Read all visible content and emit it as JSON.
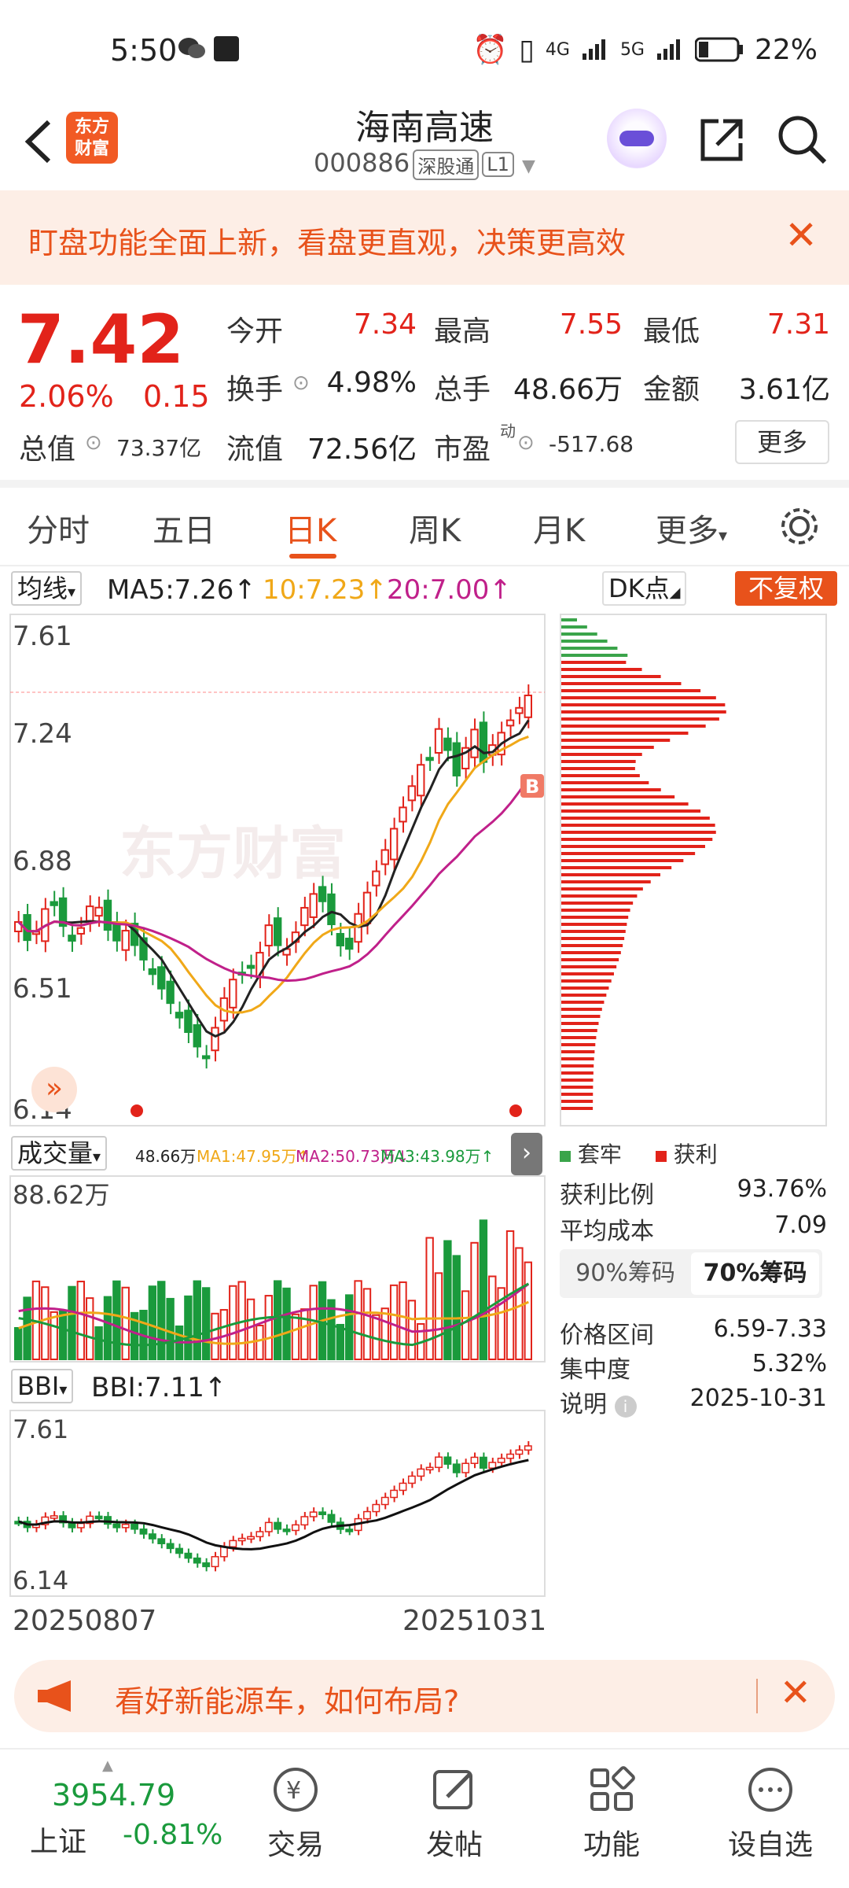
{
  "status": {
    "time": "5:50",
    "battery": "22%",
    "net1": "4G",
    "net2": "5G"
  },
  "header": {
    "title": "海南高速",
    "code": "000886",
    "tag1": "深股通",
    "tag2": "L1",
    "logo_line1": "东方",
    "logo_line2": "财富"
  },
  "banner": {
    "text": "盯盘功能全面上新，看盘更直观，决策更高效"
  },
  "quote": {
    "price": "7.42",
    "pct": "2.06%",
    "change": "0.15",
    "open_label": "今开",
    "open": "7.34",
    "high_label": "最高",
    "high": "7.55",
    "low_label": "最低",
    "low": "7.31",
    "turnover_label": "换手",
    "turnover": "4.98%",
    "volume_label": "总手",
    "volume": "48.66万",
    "amount_label": "金额",
    "amount": "3.61亿",
    "mktcap_label": "总值",
    "mktcap": "73.37亿",
    "float_label": "流值",
    "float": "72.56亿",
    "pe_label": "市盈",
    "pe_sup": "动",
    "pe": "-517.68",
    "more": "更多"
  },
  "tabs": [
    "分时",
    "五日",
    "日K",
    "周K",
    "月K",
    "更多"
  ],
  "ma": {
    "selector": "均线",
    "ma5": "MA5:7.26↑",
    "ma10": "10:7.23↑",
    "ma20": "20:7.00↑",
    "dk": "DK点",
    "fq": "不复权",
    "watermark": "东方财富",
    "buy_marker": "B"
  },
  "kline_axis": {
    "y1": "7.61",
    "y2": "7.24",
    "y3": "6.88",
    "y4": "6.51",
    "y5": "6.14"
  },
  "volume": {
    "selector": "成交量",
    "vol": "48.66万",
    "ma1": "MA1:47.95万↑",
    "ma2": "MA2:50.73万↓",
    "ma3": "MA3:43.98万↑",
    "max": "88.62万"
  },
  "bbi": {
    "selector": "BBI",
    "value": "BBI:7.11↑",
    "y_top": "7.61",
    "y_bot": "6.14"
  },
  "dates": {
    "start": "20250807",
    "end": "20251031"
  },
  "chips": {
    "legend_trap": "套牢",
    "legend_profit": "获利",
    "profit_ratio_label": "获利比例",
    "profit_ratio": "93.76%",
    "avg_cost_label": "平均成本",
    "avg_cost": "7.09",
    "btn90": "90%筹码",
    "btn70": "70%筹码",
    "range_label": "价格区间",
    "range": "6.59-7.33",
    "conc_label": "集中度",
    "conc": "5.32%",
    "note_label": "说明",
    "note_date": "2025-10-31"
  },
  "ad": {
    "text": "看好新能源车，如何布局?"
  },
  "bottom": {
    "index_value": "3954.79",
    "index_name": "上证",
    "index_pct": "-0.81%",
    "nav": [
      "交易",
      "发帖",
      "功能",
      "设自选"
    ]
  },
  "colors": {
    "up": "#e2231a",
    "down": "#1a9a3c",
    "accent": "#e8521b"
  }
}
